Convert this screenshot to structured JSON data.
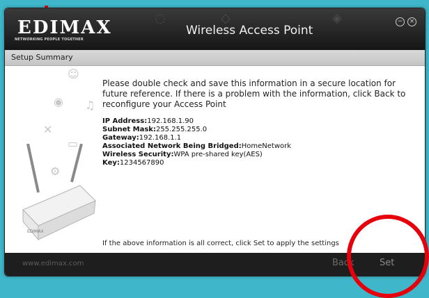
{
  "header": {
    "logo": "EDIMAX",
    "tagline": "NETWORKING PEOPLE TOGETHER",
    "title": "Wireless Access Point",
    "minimize_glyph": "−",
    "close_glyph": "×"
  },
  "subbar": {
    "label": "Setup Summary"
  },
  "content": {
    "intro": "Please double check and save this information in a secure location for future reference. If there is a problem with the information, click Back to reconfigure your Access Point",
    "fields": [
      {
        "label": "IP Address:",
        "value": "192.168.1.90"
      },
      {
        "label": "Subnet Mask:",
        "value": "255.255.255.0"
      },
      {
        "label": "Gateway:",
        "value": "192.168.1.1"
      },
      {
        "label": "Associated Network Being Bridged:",
        "value": "HomeNetwork"
      },
      {
        "label": "Wireless Security:",
        "value": "WPA pre-shared key(AES)"
      },
      {
        "label": "Key:",
        "value": "1234567890"
      }
    ],
    "footer_note": "If the above information is all correct, click Set to apply the settings"
  },
  "bottom": {
    "url": "www.edimax.com",
    "back_label": "Back",
    "set_label": "Set"
  },
  "colors": {
    "highlight": "#e5000c",
    "background": "#3fb6c9"
  },
  "icons": [
    "minimize-icon",
    "close-icon",
    "router-image"
  ]
}
